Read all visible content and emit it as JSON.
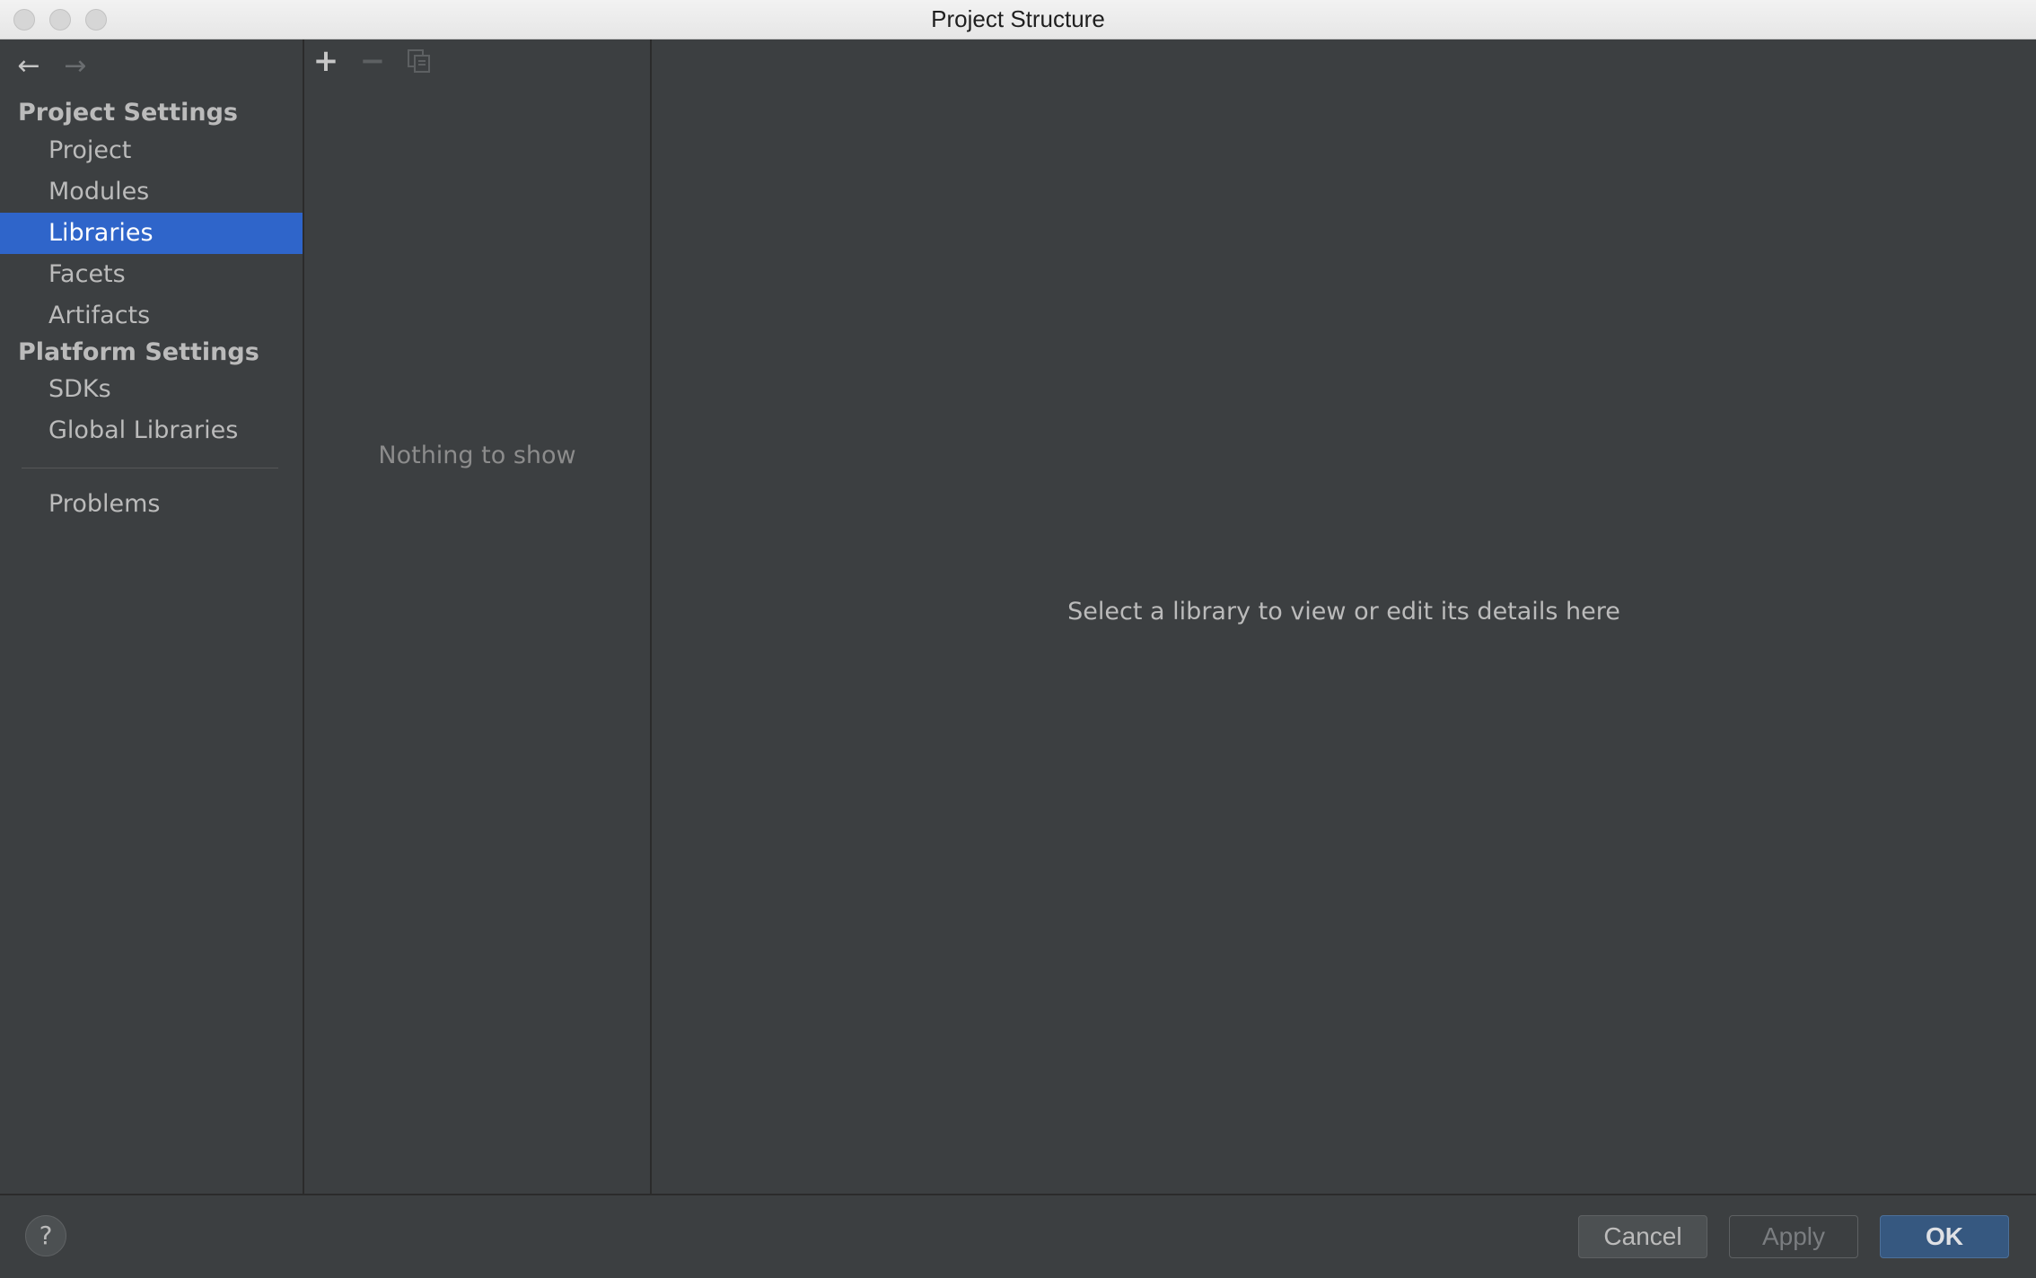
{
  "window": {
    "title": "Project Structure"
  },
  "navigation": {
    "back_icon": "arrow-left-icon",
    "forward_icon": "arrow-right-icon"
  },
  "sidebar": {
    "project_settings_header": "Project Settings",
    "project_items": [
      "Project",
      "Modules",
      "Libraries",
      "Facets",
      "Artifacts"
    ],
    "selected_item": "Libraries",
    "platform_settings_header": "Platform Settings",
    "platform_items": [
      "SDKs",
      "Global Libraries"
    ],
    "problems_label": "Problems"
  },
  "list_panel": {
    "toolbar": {
      "add_icon": "plus-icon",
      "remove_icon": "minus-icon",
      "copy_icon": "copy-icon"
    },
    "empty_text": "Nothing to show"
  },
  "detail_panel": {
    "placeholder_text": "Select a library to view or edit its details here"
  },
  "footer": {
    "help_label": "?",
    "cancel_label": "Cancel",
    "apply_label": "Apply",
    "ok_label": "OK"
  },
  "colors": {
    "background": "#3c3f41",
    "selection": "#2f65ca",
    "ok_button": "#365880",
    "text": "#bbbbbb"
  }
}
